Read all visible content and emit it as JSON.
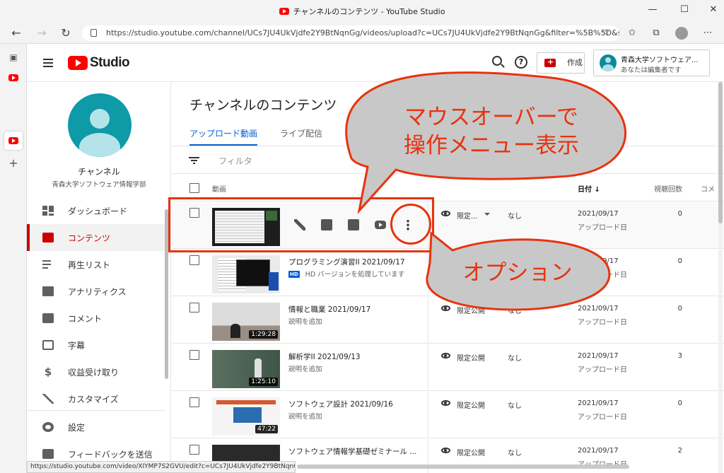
{
  "window": {
    "title": "チャンネルのコンテンツ - YouTube Studio"
  },
  "browser": {
    "url": "https://studio.youtube.com/channel/UCs7JU4UkVjdfe2Y9BtNqnGg/videos/upload?c=UCs7JU4UkVjdfe2Y9BtNqnGg&filter=%5B%5D&sort...",
    "status_url": "https://studio.youtube.com/video/XIYMP7S2GVU/edit?c=UCs7JU4UkVjdfe2Y9BtNqnGg"
  },
  "header": {
    "logo": "Studio",
    "create_label": "作成",
    "account_name": "青森大学ソフトウェア...",
    "account_role": "あなたは編集者です"
  },
  "channel": {
    "name": "チャンネル",
    "subtitle": "青森大学ソフトウェア情報学部"
  },
  "nav": [
    {
      "label": "ダッシュボード",
      "icon": "dashboard-icon"
    },
    {
      "label": "コンテンツ",
      "icon": "content-icon",
      "active": true
    },
    {
      "label": "再生リスト",
      "icon": "playlist-icon"
    },
    {
      "label": "アナリティクス",
      "icon": "analytics-icon"
    },
    {
      "label": "コメント",
      "icon": "comment-icon"
    },
    {
      "label": "字幕",
      "icon": "subtitles-icon"
    },
    {
      "label": "収益受け取り",
      "icon": "monetization-icon"
    },
    {
      "label": "カスタマイズ",
      "icon": "customize-icon"
    },
    {
      "label": "設定",
      "icon": "settings-icon"
    },
    {
      "label": "フィードバックを送信",
      "icon": "feedback-icon"
    }
  ],
  "main": {
    "title": "チャンネルのコンテンツ",
    "tabs": [
      "アップロード動画",
      "ライブ配信"
    ],
    "filter_placeholder": "フィルタ",
    "columns": {
      "video": "動画",
      "date": "日付",
      "views": "視聴回数",
      "comments": "コメ"
    }
  },
  "rows": [
    {
      "title": "",
      "desc": "",
      "visibility": "限定...",
      "restriction": "なし",
      "date": "2021/09/17",
      "date_label": "アップロード日",
      "views": "0",
      "duration": ""
    },
    {
      "title": "プログラミング演習II 2021/09/17",
      "desc": "HD バージョンを処理しています",
      "hd": "HD",
      "visibility": "",
      "restriction": "",
      "date": "2021/09/17",
      "date_label": "アップロード日",
      "views": "0",
      "duration": ""
    },
    {
      "title": "情報と職業 2021/09/17",
      "desc": "説明を追加",
      "visibility": "限定公開",
      "restriction": "なし",
      "date": "2021/09/17",
      "date_label": "アップロード日",
      "views": "0",
      "duration": "1:29:28"
    },
    {
      "title": "解析学II 2021/09/13",
      "desc": "説明を追加",
      "visibility": "限定公開",
      "restriction": "なし",
      "date": "2021/09/17",
      "date_label": "アップロード日",
      "views": "3",
      "duration": "1:25:10"
    },
    {
      "title": "ソフトウェア設計 2021/09/16",
      "desc": "説明を追加",
      "visibility": "限定公開",
      "restriction": "なし",
      "date": "2021/09/17",
      "date_label": "アップロード日",
      "views": "0",
      "duration": "47:22"
    },
    {
      "title": "ソフトウェア情報学基礎ゼミナール ...",
      "desc": "",
      "visibility": "限定公開",
      "restriction": "なし",
      "date": "2021/09/17",
      "date_label": "アップロード日",
      "views": "2",
      "duration": ""
    }
  ],
  "annotations": {
    "hover_line1": "マウスオーバーで",
    "hover_line2": "操作メニュー表示",
    "options": "オプション",
    "color": "#e8320e"
  }
}
